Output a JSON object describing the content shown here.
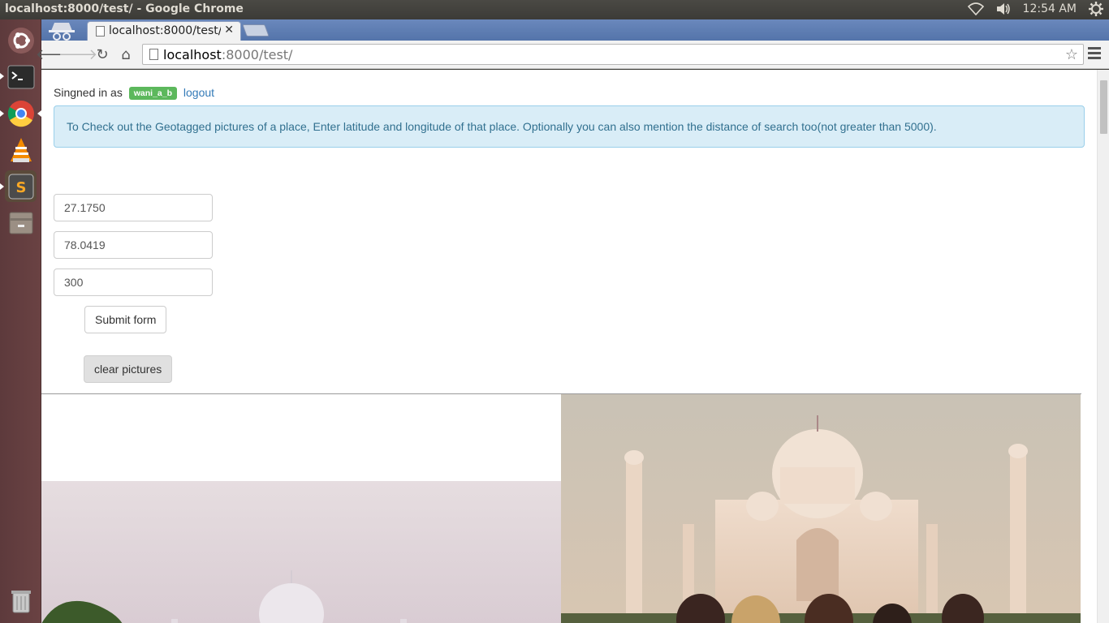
{
  "os": {
    "window_title": "localhost:8000/test/ - Google Chrome",
    "clock": "12:54 AM",
    "tray_icons": [
      "wifi-icon",
      "volume-icon",
      "settings-gear-icon"
    ],
    "launcher_items": [
      "ubuntu-dash-icon",
      "terminal-icon",
      "chrome-icon",
      "vlc-icon",
      "sublime-text-icon",
      "file-manager-icon",
      "trash-icon"
    ]
  },
  "browser": {
    "tab_title": "localhost:8000/test/",
    "url_host": "localhost",
    "url_rest": ":8000/test/"
  },
  "page": {
    "signin_prefix": "Singned in as",
    "username": "wani_a_b",
    "logout": "logout",
    "info": "To Check out the Geotagged pictures of a place, Enter latitude and longitude of that place. Optionally you can also mention the distance of search too(not greater than 5000).",
    "latitude": "27.1750",
    "longitude": "78.0419",
    "distance": "300",
    "submit_label": "Submit form",
    "clear_label": "clear pictures"
  },
  "colors": {
    "label_success": "#5cb85c",
    "alert_bg": "#d9edf7",
    "alert_text": "#31708f",
    "link": "#337ab7"
  }
}
